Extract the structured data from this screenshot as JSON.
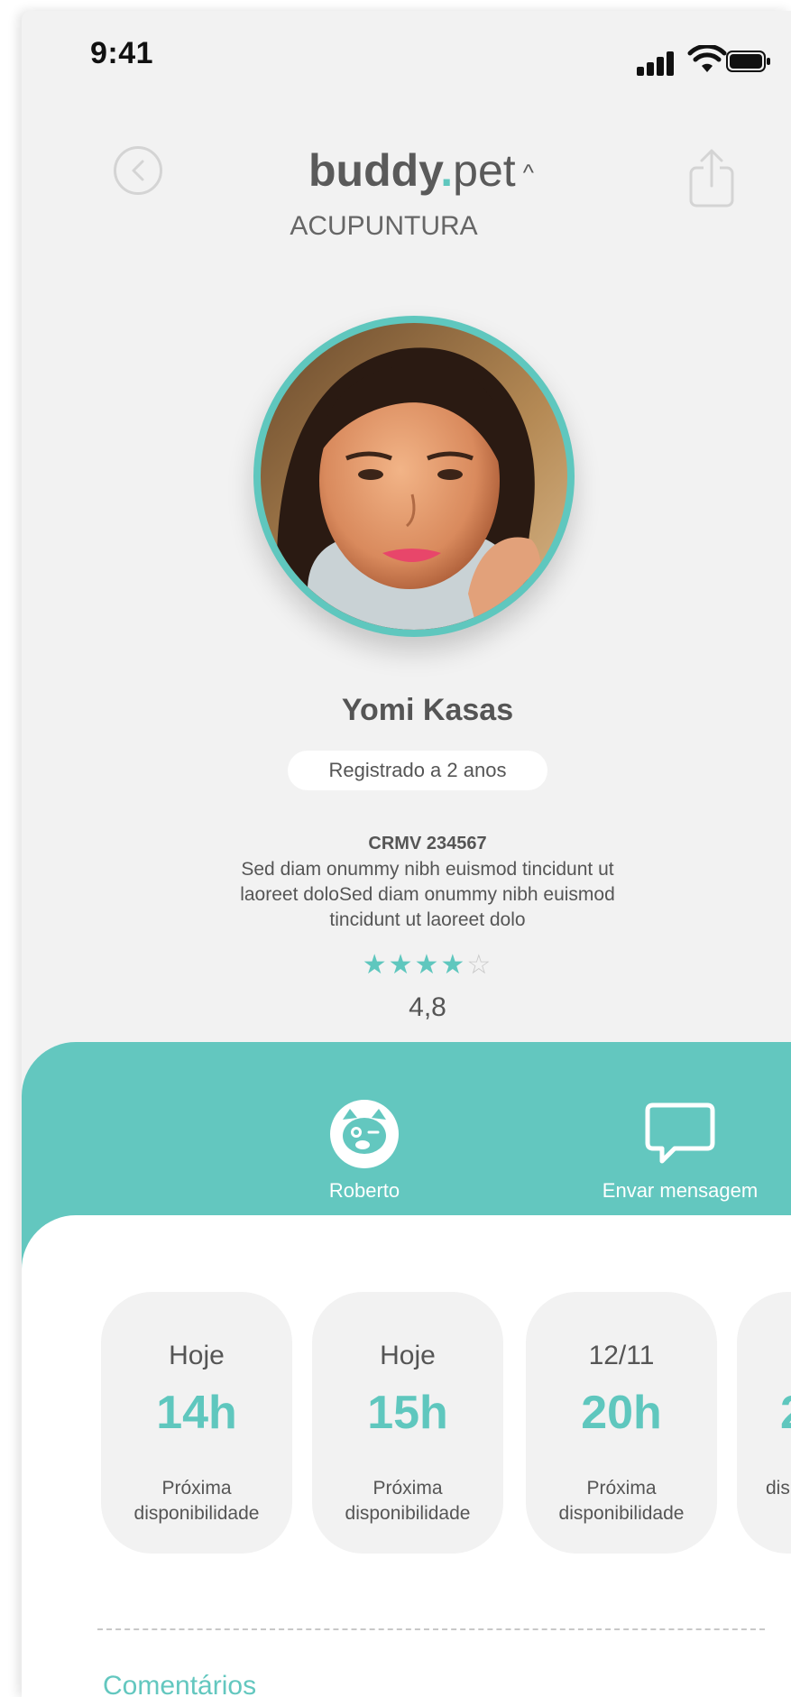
{
  "status_bar": {
    "time": "9:41"
  },
  "header": {
    "brand_bold": "buddy",
    "brand_dot": ".",
    "brand_light": "pet",
    "brand_caret": "^",
    "subtitle": "ACUPUNTURA"
  },
  "profile": {
    "name": "Yomi Kasas",
    "badge": "Registrado a 2 anos",
    "crmv": "CRMV 234567",
    "description": "Sed diam onummy nibh euismod tincidunt ut laoreet doloSed diam onummy nibh euismod tincidunt ut laoreet dolo",
    "stars_filled": "★★★★",
    "stars_empty": "☆",
    "rating": "4,8",
    "stars_value": 4
  },
  "actions": {
    "pet_label": "Roberto",
    "message_label": "Envar mensagem"
  },
  "slots": [
    {
      "day": "Hoje",
      "hour": "14h",
      "label": "Próxima disponibilidade"
    },
    {
      "day": "Hoje",
      "hour": "15h",
      "label": "Próxima disponibilidade"
    },
    {
      "day": "12/11",
      "hour": "20h",
      "label": "Próxima disponibilidade"
    },
    {
      "day": "",
      "hour": "2",
      "label": "dis"
    }
  ],
  "comments_title": "Comentários",
  "colors": {
    "accent": "#63c7bf",
    "background": "#f2f2f2",
    "text": "#555555"
  },
  "icons": [
    "back-icon",
    "share-icon",
    "pet-icon",
    "chat-icon",
    "signal-icon",
    "wifi-icon",
    "battery-icon"
  ]
}
